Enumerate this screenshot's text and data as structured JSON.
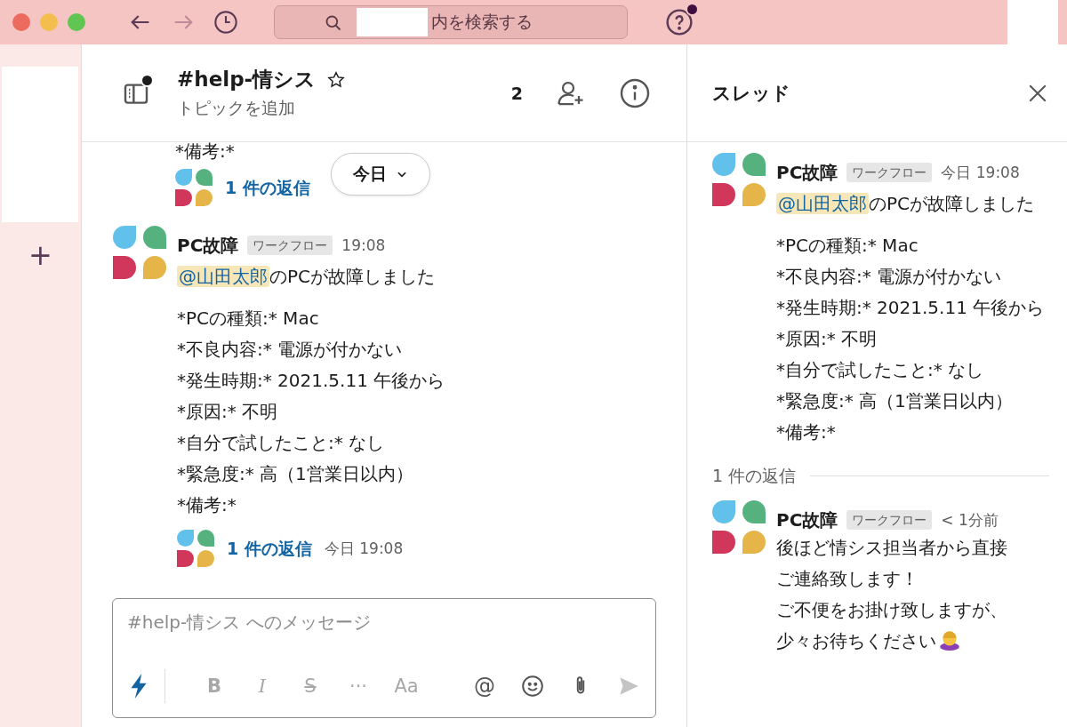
{
  "titlebar": {
    "search": {
      "placeholder": "内を検索する"
    },
    "help_unread": true
  },
  "sidebar": {
    "add": "+"
  },
  "channel": {
    "name": "#help-情シス",
    "topic": "トピックを追加",
    "starred": false,
    "member_count": "2",
    "unread": true
  },
  "messages": [
    {
      "kind": "cut",
      "details": [
        "*備考:*"
      ],
      "reply": {
        "count": "1 件の返信"
      }
    },
    {
      "kind": "full",
      "author": "PC故障",
      "badge": "ワークフロー",
      "time": "19:08",
      "mention": "@山田太郎",
      "text": "のPCが故障しました",
      "details": [
        "*PCの種類:* Mac",
        "*不良内容:* 電源が付かない",
        "*発生時期:* 2021.5.11 午後から",
        "*原因:* 不明",
        "*自分で試したこと:* なし",
        "*緊急度:* 高（1営業日以内）",
        "*備考:*"
      ],
      "reply": {
        "count": "1 件の返信",
        "time": "今日 19:08"
      }
    }
  ],
  "date_pill": "今日",
  "composer": {
    "placeholder": "#help-情シス へのメッセージ",
    "format": [
      {
        "kind": "bold",
        "label": "B",
        "disabled": true
      },
      {
        "kind": "italic",
        "label": "I",
        "disabled": true
      },
      {
        "kind": "strike",
        "label": "S",
        "disabled": true
      },
      {
        "kind": "more",
        "label": "···",
        "disabled": true
      },
      {
        "kind": "text",
        "label": "Aa",
        "disabled": true
      }
    ],
    "tools": [
      {
        "kind": "mention",
        "label": "@",
        "disabled": false
      },
      {
        "kind": "emoji",
        "disabled": false
      },
      {
        "kind": "attach",
        "disabled": false
      },
      {
        "kind": "send",
        "disabled": true
      }
    ]
  },
  "thread": {
    "title": "スレッド",
    "parent": {
      "author": "PC故障",
      "badge": "ワークフロー",
      "time": "今日 19:08",
      "mention": "@山田太郎",
      "text": "のPCが故障しました",
      "details": [
        "*PCの種類:* Mac",
        "*不良内容:* 電源が付かない",
        "*発生時期:* 2021.5.11 午後から",
        "*原因:* 不明",
        "*自分で試したこと:* なし",
        "*緊急度:* 高（1営業日以内）",
        "*備考:*"
      ]
    },
    "reply_count": "1 件の返信",
    "replies": [
      {
        "author": "PC故障",
        "badge": "ワークフロー",
        "time": "< 1分前",
        "lines": [
          "後ほど情シス担当者から直接",
          "ご連絡致します！",
          "ご不便をお掛け致しますが、",
          "少々お待ちください"
        ],
        "emoji": true
      }
    ]
  }
}
